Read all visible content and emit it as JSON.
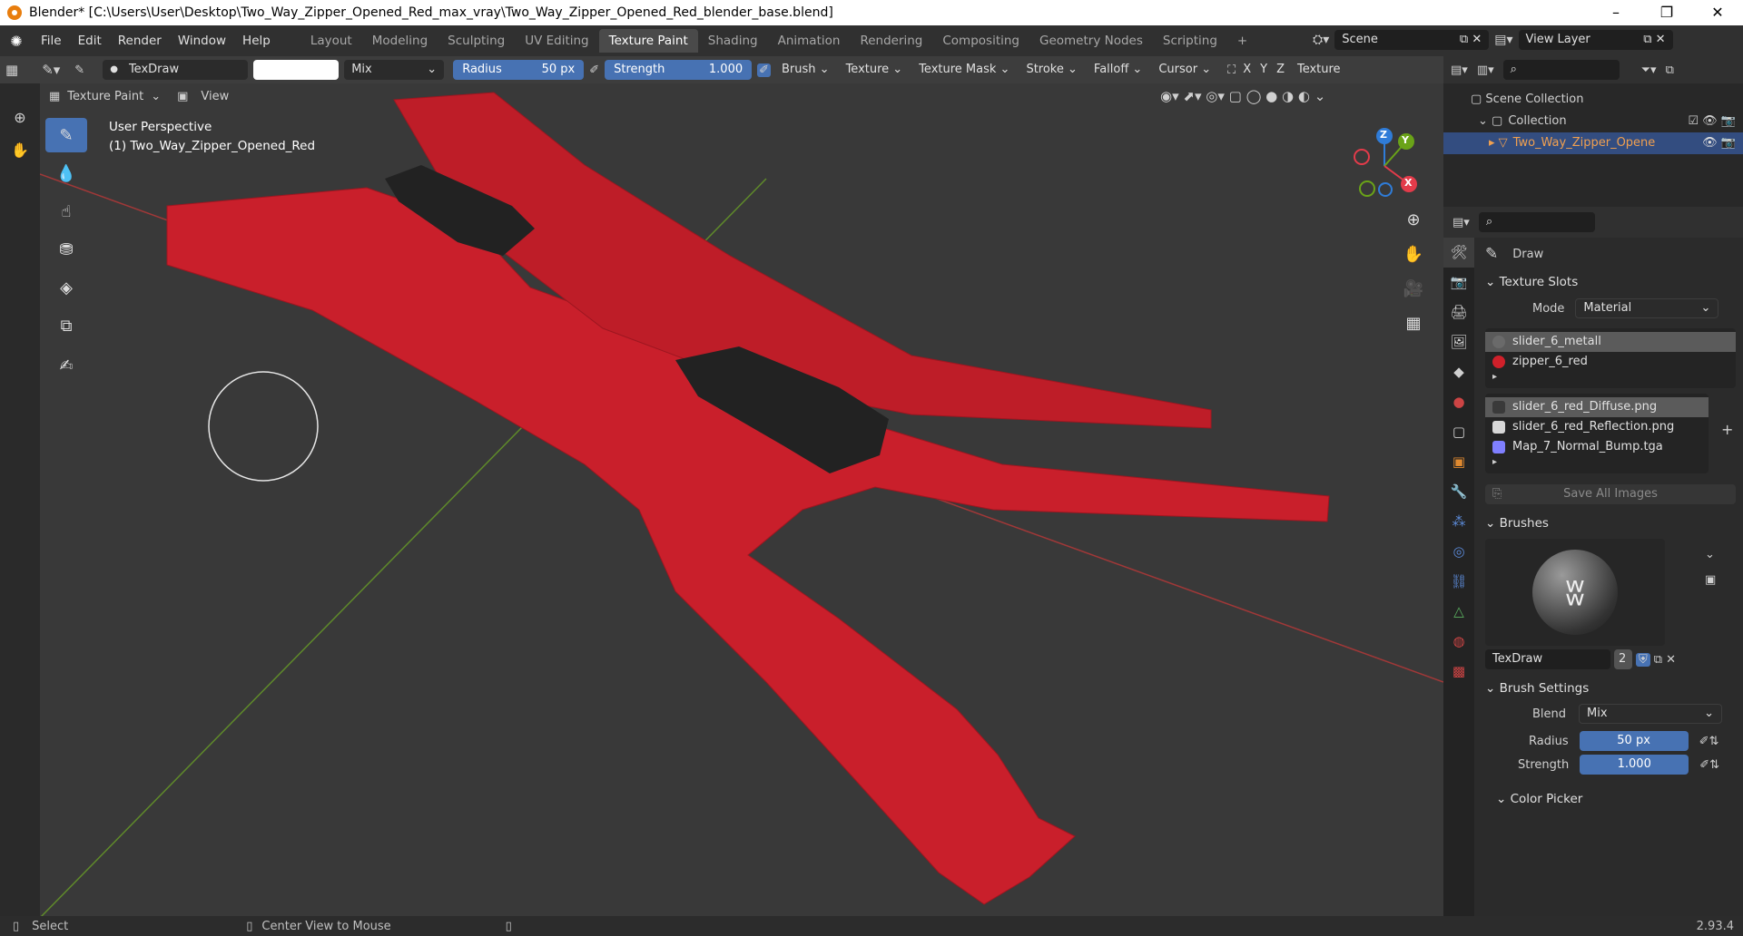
{
  "titlebar": {
    "title": "Blender* [C:\\Users\\User\\Desktop\\Two_Way_Zipper_Opened_Red_max_vray\\Two_Way_Zipper_Opened_Red_blender_base.blend]",
    "minimize": "–",
    "maximize": "❐",
    "close": "✕"
  },
  "menu": {
    "items": [
      "File",
      "Edit",
      "Render",
      "Window",
      "Help"
    ]
  },
  "workspaces": {
    "tabs": [
      "Layout",
      "Modeling",
      "Sculpting",
      "UV Editing",
      "Texture Paint",
      "Shading",
      "Animation",
      "Rendering",
      "Compositing",
      "Geometry Nodes",
      "Scripting"
    ],
    "active": "Texture Paint",
    "add": "+"
  },
  "scene": {
    "label": "Scene",
    "view_layer": "View Layer"
  },
  "toolheader": {
    "brush_name": "TexDraw",
    "blend": "Mix",
    "radius_label": "Radius",
    "radius_value": "50 px",
    "strength_label": "Strength",
    "strength_value": "1.000",
    "menus": [
      "Brush",
      "Texture",
      "Texture Mask",
      "Stroke",
      "Falloff",
      "Cursor"
    ],
    "axes": [
      "X",
      "Y",
      "Z"
    ],
    "texture_tab": "Texture"
  },
  "viewheader": {
    "mode": "Texture Paint",
    "view": "View"
  },
  "overlay": {
    "line1": "User Perspective",
    "line2": "(1) Two_Way_Zipper_Opened_Red"
  },
  "gizmo": {
    "z": "Z",
    "y": "Y",
    "x": "X"
  },
  "outliner": {
    "scene_collection": "Scene Collection",
    "collection": "Collection",
    "object": "Two_Way_Zipper_Opene"
  },
  "props": {
    "tool_name": "Draw",
    "texture_slots_title": "Texture Slots",
    "mode_label": "Mode",
    "mode_value": "Material",
    "materials": [
      {
        "name": "slider_6_metall",
        "color": "#6a6a6a"
      },
      {
        "name": "zipper_6_red",
        "color": "#d0202a"
      }
    ],
    "images": [
      {
        "name": "slider_6_red_Diffuse.png",
        "color": "#3a3a3a"
      },
      {
        "name": "slider_6_red_Reflection.png",
        "color": "#d8d8d8"
      },
      {
        "name": "Map_7_Normal_Bump.tga",
        "color": "#7f7fff"
      }
    ],
    "save_all": "Save All Images",
    "brushes_title": "Brushes",
    "brush_name": "TexDraw",
    "brush_users": "2",
    "brush_settings_title": "Brush Settings",
    "blend_label": "Blend",
    "blend_value": "Mix",
    "radius_label": "Radius",
    "radius_value": "50 px",
    "strength_label": "Strength",
    "strength_value": "1.000",
    "color_picker": "Color Picker"
  },
  "status": {
    "select": "Select",
    "center": "Center View to Mouse",
    "version": "2.93.4"
  }
}
